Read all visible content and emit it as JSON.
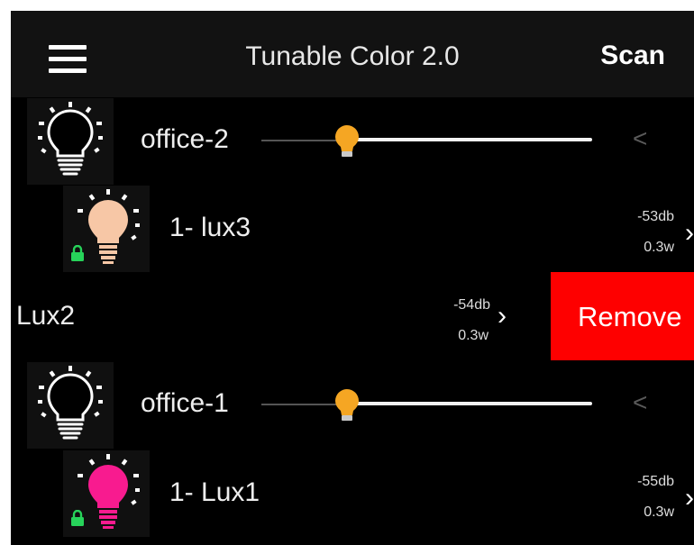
{
  "header": {
    "title": "Tunable Color 2.0",
    "scan_label": "Scan",
    "menu_icon": "hamburger-menu-icon"
  },
  "groups": [
    {
      "name": "office-2",
      "brightness_percent": 26,
      "expand_icon": "<",
      "lights": [
        {
          "name": "1- lux3",
          "signal": "-53db",
          "power": "0.3w",
          "color": "#f7c7a6",
          "locked": true
        }
      ]
    },
    {
      "name": "office-1",
      "brightness_percent": 26,
      "expand_icon": "<",
      "lights": [
        {
          "name": "1- Lux1",
          "signal": "-55db",
          "power": "0.3w",
          "color": "#f81b8f",
          "locked": true
        }
      ]
    }
  ],
  "swiped_row": {
    "name": "Lux2",
    "signal": "-54db",
    "power": "0.3w",
    "remove_label": "Remove"
  },
  "colors": {
    "remove": "#fe0000",
    "lock": "#27d35a",
    "thumb": "#f5a623",
    "background": "#000000"
  }
}
